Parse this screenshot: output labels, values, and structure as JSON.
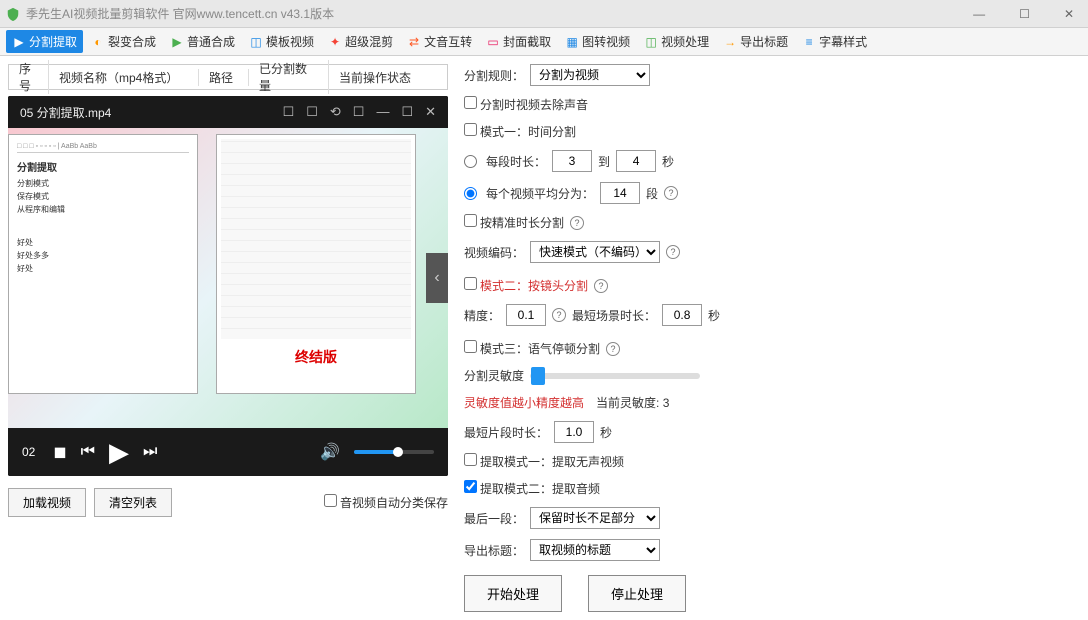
{
  "titlebar": {
    "text": "季先生AI视频批量剪辑软件    官网www.tencett.cn   v43.1版本"
  },
  "tabs": [
    {
      "icon": "▶",
      "label": "分割提取",
      "active": true,
      "color": "#1e88e5"
    },
    {
      "icon": "◐",
      "label": "裂变合成",
      "active": false,
      "color": "#ff9800"
    },
    {
      "icon": "▶",
      "label": "普通合成",
      "active": false,
      "color": "#4caf50"
    },
    {
      "icon": "◫",
      "label": "模板视频",
      "active": false,
      "color": "#1e88e5"
    },
    {
      "icon": "✦",
      "label": "超级混剪",
      "active": false,
      "color": "#f44336"
    },
    {
      "icon": "⇄",
      "label": "文音互转",
      "active": false,
      "color": "#ff5722"
    },
    {
      "icon": "▭",
      "label": "封面截取",
      "active": false,
      "color": "#e91e63"
    },
    {
      "icon": "▦",
      "label": "图转视频",
      "active": false,
      "color": "#1e88e5"
    },
    {
      "icon": "◫",
      "label": "视频处理",
      "active": false,
      "color": "#4caf50"
    },
    {
      "icon": "→",
      "label": "导出标题",
      "active": false,
      "color": "#ff9800"
    },
    {
      "icon": "≡",
      "label": "字幕样式",
      "active": false,
      "color": "#1e88e5"
    }
  ],
  "table_headers": [
    "序号",
    "视频名称（mp4格式）",
    "路径",
    "已分割数量",
    "当前操作状态"
  ],
  "player": {
    "title": "05 分割提取.mp4",
    "time": "02",
    "doc_title": "分割提取",
    "doc_lines": [
      "分割模式",
      "保存模式",
      "从程序和编辑"
    ],
    "doc_lines2": [
      "好处",
      "好处多多",
      "好处"
    ],
    "panel_red": "终结版"
  },
  "bottom": {
    "load_btn": "加载视频",
    "clear_btn": "清空列表",
    "autosave_label": "音视频自动分类保存"
  },
  "form": {
    "split_rule_label": "分割规则：",
    "split_rule_value": "分割为视频",
    "remove_audio": "分割时视频去除声音",
    "mode1_label": "模式一：时间分割",
    "each_duration_label": "每段时长：",
    "each_duration_from": "3",
    "each_duration_to_label": "到",
    "each_duration_to": "4",
    "seconds": "秒",
    "avg_split_label": "每个视频平均分为：",
    "avg_split_value": "14",
    "segments": "段",
    "precise_split": "按精准时长分割",
    "encoding_label": "视频编码：",
    "encoding_value": "快速模式（不编码）",
    "mode2_label": "模式二：按镜头分割",
    "precision_label": "精度：",
    "precision_value": "0.1",
    "min_scene_label": "最短场景时长：",
    "min_scene_value": "0.8",
    "mode3_label": "模式三：语气停顿分割",
    "sensitivity_label": "分割灵敏度",
    "sensitivity_note": "灵敏度值越小精度越高",
    "current_sensitivity_label": "当前灵敏度: ",
    "current_sensitivity_value": "3",
    "min_clip_label": "最短片段时长：",
    "min_clip_value": "1.0",
    "extract1": "提取模式一：提取无声视频",
    "extract2": "提取模式二：提取音频",
    "last_seg_label": "最后一段：",
    "last_seg_value": "保留时长不足部分",
    "export_title_label": "导出标题：",
    "export_title_value": "取视频的标题",
    "start_btn": "开始处理",
    "stop_btn": "停止处理"
  }
}
